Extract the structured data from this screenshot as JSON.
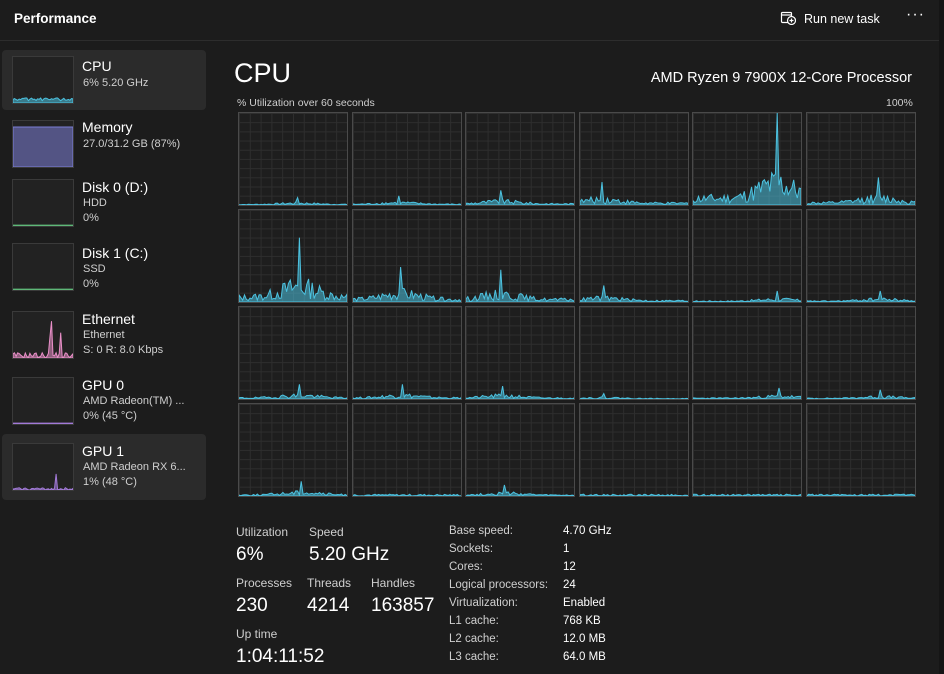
{
  "header": {
    "title": "Performance",
    "run_new_task": "Run new task",
    "more": "···"
  },
  "sidebar": {
    "items": [
      {
        "name": "CPU",
        "line1": "6%  5.20 GHz",
        "line2": "",
        "graph": "cpu",
        "color": "#4cc2e0"
      },
      {
        "name": "Memory",
        "line1": "27.0/31.2 GB (87%)",
        "line2": "",
        "graph": "memory",
        "color": "#7b7ed6"
      },
      {
        "name": "Disk 0 (D:)",
        "line1": "HDD",
        "line2": "0%",
        "graph": "flat",
        "color": "#5fb878"
      },
      {
        "name": "Disk 1 (C:)",
        "line1": "SSD",
        "line2": "0%",
        "graph": "flat",
        "color": "#5fb878"
      },
      {
        "name": "Ethernet",
        "line1": "Ethernet",
        "line2": "S: 0  R: 8.0 Kbps",
        "graph": "ethernet",
        "color": "#e98fc8"
      },
      {
        "name": "GPU 0",
        "line1": "AMD Radeon(TM) ...",
        "line2": "0%  (45 °C)",
        "graph": "flat",
        "color": "#a27ad8"
      },
      {
        "name": "GPU 1",
        "line1": "AMD Radeon RX 6...",
        "line2": "1%  (48 °C)",
        "graph": "gpu1",
        "color": "#a27ad8"
      }
    ]
  },
  "main": {
    "heading": "CPU",
    "processor": "AMD Ryzen 9 7900X 12-Core Processor",
    "util_label": "% Utilization over 60 seconds",
    "util_max": "100%",
    "accent": "#4cc2e0"
  },
  "stats": {
    "utilization_label": "Utilization",
    "utilization": "6%",
    "speed_label": "Speed",
    "speed": "5.20 GHz",
    "processes_label": "Processes",
    "processes": "230",
    "threads_label": "Threads",
    "threads": "4214",
    "handles_label": "Handles",
    "handles": "163857",
    "uptime_label": "Up time",
    "uptime": "1:04:11:52"
  },
  "specs": [
    {
      "key": "Base speed:",
      "value": "4.70 GHz"
    },
    {
      "key": "Sockets:",
      "value": "1"
    },
    {
      "key": "Cores:",
      "value": "12"
    },
    {
      "key": "Logical processors:",
      "value": "24"
    },
    {
      "key": "Virtualization:",
      "value": "Enabled"
    },
    {
      "key": "L1 cache:",
      "value": "768 KB"
    },
    {
      "key": "L2 cache:",
      "value": "12.0 MB"
    },
    {
      "key": "L3 cache:",
      "value": "64.0 MB"
    }
  ],
  "cores": [
    {
      "id": 0,
      "peak": 0.08
    },
    {
      "id": 1,
      "peak": 0.1
    },
    {
      "id": 2,
      "peak": 0.16
    },
    {
      "id": 3,
      "peak": 0.25
    },
    {
      "id": 4,
      "peak": 1.0
    },
    {
      "id": 5,
      "peak": 0.3
    },
    {
      "id": 6,
      "peak": 0.7
    },
    {
      "id": 7,
      "peak": 0.38
    },
    {
      "id": 8,
      "peak": 0.35
    },
    {
      "id": 9,
      "peak": 0.18
    },
    {
      "id": 10,
      "peak": 0.12
    },
    {
      "id": 11,
      "peak": 0.12
    },
    {
      "id": 12,
      "peak": 0.16
    },
    {
      "id": 13,
      "peak": 0.16
    },
    {
      "id": 14,
      "peak": 0.14
    },
    {
      "id": 15,
      "peak": 0.06
    },
    {
      "id": 16,
      "peak": 0.12
    },
    {
      "id": 17,
      "peak": 0.1
    },
    {
      "id": 18,
      "peak": 0.16
    },
    {
      "id": 19,
      "peak": 0.02
    },
    {
      "id": 20,
      "peak": 0.12
    },
    {
      "id": 21,
      "peak": 0.02
    },
    {
      "id": 22,
      "peak": 0.02
    },
    {
      "id": 23,
      "peak": 0.02
    }
  ]
}
